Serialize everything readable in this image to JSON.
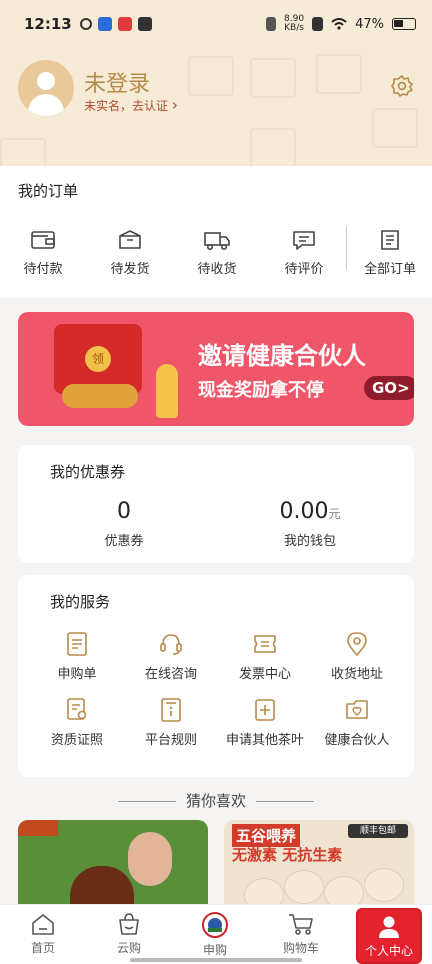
{
  "status": {
    "time": "12:13",
    "speed_value": "8.90",
    "speed_unit": "KB/s",
    "battery": "47%"
  },
  "user": {
    "name": "未登录",
    "sub": "未实名，去认证",
    "sub_arrow": "›"
  },
  "orders": {
    "title": "我的订单",
    "items": [
      {
        "label": "待付款",
        "icon": "wallet-icon"
      },
      {
        "label": "待发货",
        "icon": "box-icon"
      },
      {
        "label": "待收货",
        "icon": "truck-icon"
      },
      {
        "label": "待评价",
        "icon": "comment-icon"
      },
      {
        "label": "全部订单",
        "icon": "list-icon"
      }
    ]
  },
  "banner": {
    "title": "邀请健康合伙人",
    "subtitle": "现金奖励拿不停",
    "go": "GO>",
    "coin_char": "领"
  },
  "coupons": {
    "title": "我的优惠券",
    "coupon_count": "0",
    "coupon_label": "优惠券",
    "wallet_amount": "0.00",
    "wallet_unit": "元",
    "wallet_label": "我的钱包"
  },
  "services": {
    "title": "我的服务",
    "items": [
      {
        "label": "申购单",
        "icon": "document-icon"
      },
      {
        "label": "在线咨询",
        "icon": "headset-icon"
      },
      {
        "label": "发票中心",
        "icon": "invoice-icon"
      },
      {
        "label": "收货地址",
        "icon": "location-icon"
      },
      {
        "label": "资质证照",
        "icon": "certificate-icon"
      },
      {
        "label": "平台规则",
        "icon": "rules-icon"
      },
      {
        "label": "申请其他茶叶",
        "icon": "add-icon"
      },
      {
        "label": "健康合伙人",
        "icon": "partner-icon"
      }
    ]
  },
  "guess": {
    "title": "猜你喜欢"
  },
  "products": [
    {
      "line1": "",
      "line2": ""
    },
    {
      "line1": "五谷喂养",
      "line2": "无激素 无抗生素",
      "seal": "顺丰包邮"
    }
  ],
  "tabbar": {
    "items": [
      {
        "label": "首页",
        "icon": "home-icon"
      },
      {
        "label": "云购",
        "icon": "cloud-bag-icon"
      },
      {
        "label": "申购",
        "icon": "subscribe-logo-icon"
      },
      {
        "label": "购物车",
        "icon": "cart-icon"
      },
      {
        "label": "个人中心",
        "icon": "person-icon"
      }
    ],
    "active_color": "#e4232f"
  },
  "colors": {
    "accent": "#b88a4a",
    "banner": "#f0566a",
    "active": "#e4232f"
  }
}
